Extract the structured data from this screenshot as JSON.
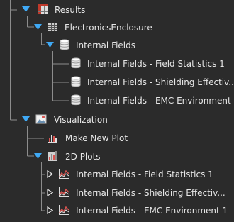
{
  "tree": {
    "results": {
      "label": "Results",
      "icon": "table-icon",
      "expanded": true
    },
    "electronics": {
      "label": "ElectronicsEnclosure",
      "icon": "grid-table-icon",
      "expanded": true
    },
    "internal_fields": {
      "label": "Internal Fields",
      "icon": "database-icon",
      "expanded": true
    },
    "datasets": [
      {
        "label": "Internal Fields - Field Statistics 1",
        "icon": "database-icon"
      },
      {
        "label": "Internal Fields - Shielding Effectiv...",
        "icon": "database-icon"
      },
      {
        "label": "Internal Fields - EMC Environment 1",
        "icon": "database-icon"
      }
    ],
    "visualization": {
      "label": "Visualization",
      "icon": "image-icon",
      "expanded": true
    },
    "make_new_plot": {
      "label": "Make New Plot",
      "icon": "bar-chart-icon"
    },
    "plots_2d": {
      "label": "2D Plots",
      "icon": "folder-chart-icon",
      "expanded": true
    },
    "plots": [
      {
        "label": "Internal Fields - Field Statistics 1",
        "icon": "line-plot-icon",
        "expanded": false
      },
      {
        "label": "Internal Fields - Shielding Effectiv...",
        "icon": "line-plot-icon",
        "expanded": false
      },
      {
        "label": "Internal Fields - EMC Environment 1",
        "icon": "line-plot-icon",
        "expanded": false
      }
    ]
  },
  "colors": {
    "background": "#2b2b2b",
    "text": "#e6e6e6",
    "twisty_blue": "#3fa9f5",
    "tree_line": "#8c8c8c",
    "plot_red": "#d9534f"
  }
}
